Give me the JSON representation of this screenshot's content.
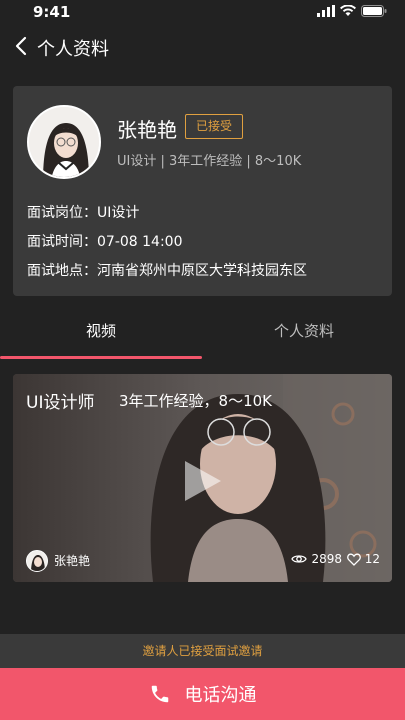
{
  "status_bar": {
    "time": "9:41"
  },
  "nav": {
    "title": "个人资料"
  },
  "profile": {
    "name": "张艳艳",
    "badge": "已接受",
    "summary": "UI设计 | 3年工作经验 | 8～10K",
    "details": [
      {
        "label": "面试岗位：",
        "value": "UI设计"
      },
      {
        "label": "面试时间：",
        "value": "07-08 14:00"
      },
      {
        "label": "面试地点：",
        "value": "河南省郑州中原区大学科技园东区"
      }
    ]
  },
  "tabs": [
    {
      "label": "视频",
      "active": true
    },
    {
      "label": "个人资料",
      "active": false
    }
  ],
  "video": {
    "title": "UI设计师",
    "subtitle": "3年工作经验，8～10K",
    "author": "张艳艳",
    "views": "2898",
    "likes": "12"
  },
  "notice": "邀请人已接受面试邀请",
  "call_button": {
    "label": "电话沟通"
  },
  "colors": {
    "accent": "#f2566b",
    "badge": "#e0a040",
    "background": "#222222",
    "card": "#3a3a3a"
  }
}
